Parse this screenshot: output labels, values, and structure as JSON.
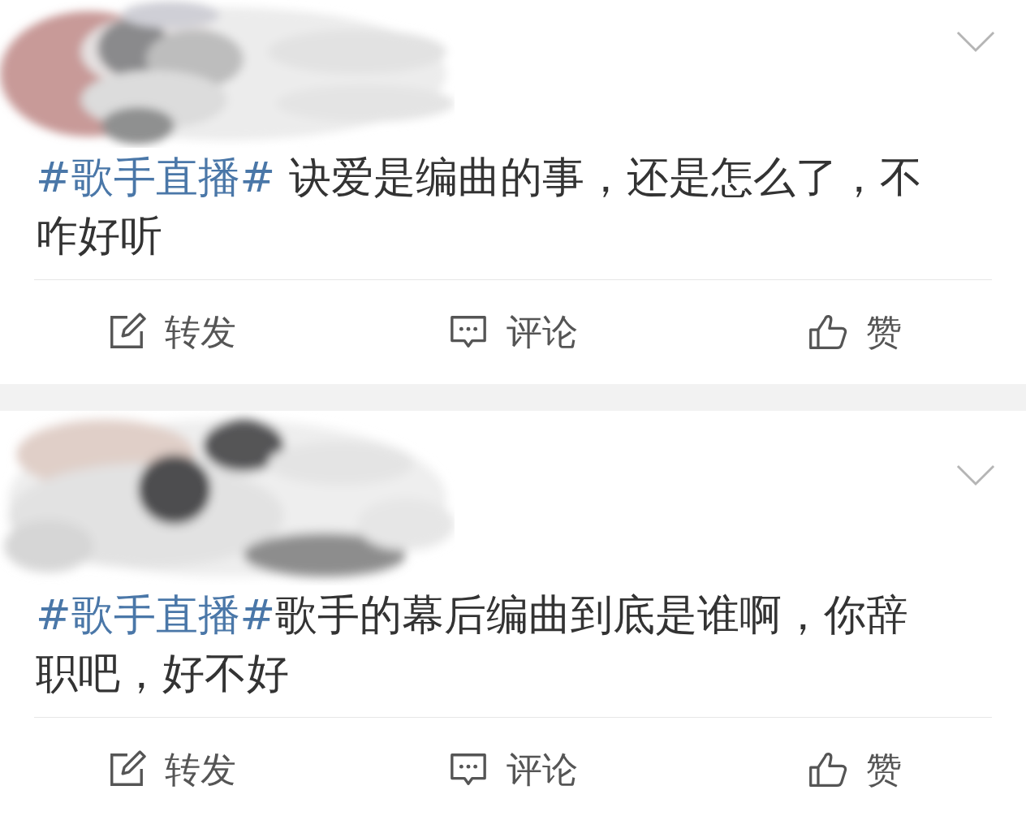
{
  "posts": [
    {
      "hashtag": "#歌手直播#",
      "text": " 诀爱是编曲的事，还是怎么了，不咋好听",
      "actions": [
        {
          "kind": "repost",
          "label": "转发"
        },
        {
          "kind": "comment",
          "label": "评论"
        },
        {
          "kind": "like",
          "label": "赞"
        }
      ]
    },
    {
      "hashtag": "#歌手直播#",
      "text": "歌手的幕后编曲到底是谁啊，你辞职吧，好不好",
      "actions": [
        {
          "kind": "repost",
          "label": "转发"
        },
        {
          "kind": "comment",
          "label": "评论"
        },
        {
          "kind": "like",
          "label": "赞"
        }
      ]
    }
  ]
}
